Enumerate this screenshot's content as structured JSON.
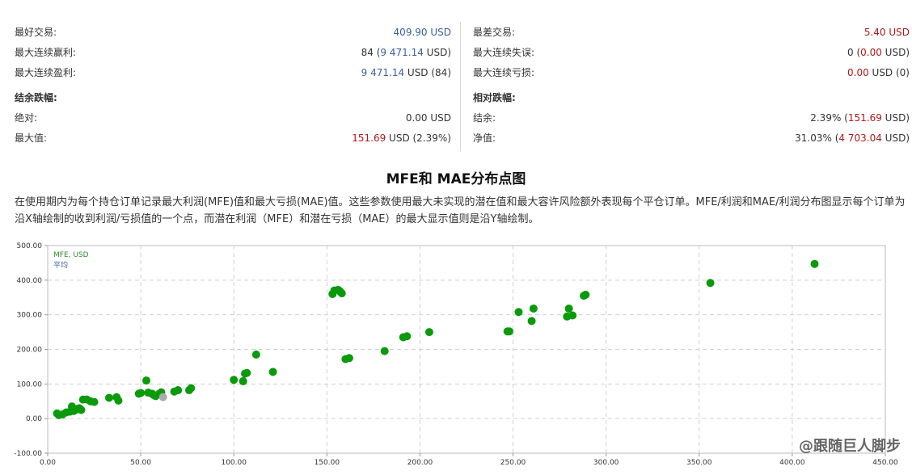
{
  "stats": {
    "left": [
      {
        "label": "最好交易:",
        "value": "409.90 USD",
        "tone": "blue"
      },
      {
        "label": "最大连续赢利:",
        "value": "84 (9 471.14 USD)",
        "tone": "mixed",
        "parts": [
          "84 (",
          "9 471.14",
          " USD)"
        ]
      },
      {
        "label": "最大连续盈利:",
        "value": "9 471.14 USD (84)",
        "tone": "mixed",
        "parts": [
          "",
          "9 471.14",
          " USD (84)"
        ]
      },
      {
        "label": "结余跌幅:",
        "value": "",
        "head": true
      },
      {
        "label": "绝对:",
        "value": "0.00 USD",
        "tone": "plain"
      },
      {
        "label": "最大值:",
        "value": "151.69 USD (2.39%)",
        "tone": "mixedred",
        "parts": [
          "",
          "151.69",
          " USD (2.39%)"
        ]
      }
    ],
    "right": [
      {
        "label": "最差交易:",
        "value": "5.40 USD",
        "tone": "red"
      },
      {
        "label": "最大连续失误:",
        "value": "0 (0.00 USD)",
        "tone": "mixedred",
        "parts": [
          "0 (",
          "0.00",
          " USD)"
        ]
      },
      {
        "label": "最大连续亏损:",
        "value": "0.00 USD (0)",
        "tone": "mixedred",
        "parts": [
          "",
          "0.00",
          " USD (0)"
        ]
      },
      {
        "label": "相对跌幅:",
        "value": "",
        "head": true
      },
      {
        "label": "结余:",
        "value": "2.39% (151.69 USD)",
        "tone": "mixedred",
        "parts": [
          "2.39% (",
          "151.69",
          " USD)"
        ]
      },
      {
        "label": "净值:",
        "value": "31.03% (4 703.04 USD)",
        "tone": "mixedred",
        "parts": [
          "31.03% (",
          "4 703.04",
          " USD)"
        ]
      }
    ]
  },
  "section_title": "MFE和 MAE分布点图",
  "description": "在使用期内为每个持仓订单记录最大利润(MFE)值和最大亏损(MAE)值。这些参数使用最大未实现的潜在值和最大容许风险额外表现每个平仓订单。MFE/利润和MAE/利润分布图显示每个订单为沿X轴绘制的收到利润/亏损值的一个点，而潜在利润（MFE）和潜在亏损（MAE）的最大显示值则是沿Y轴绘制。",
  "watermark": "@跟随巨人脚步",
  "colors": {
    "series": "#0b9a0b",
    "average": "#aaaaaa",
    "grid": "#d0d0d0",
    "blue": "#3a5fa0",
    "red": "#b01818"
  },
  "chart_data": {
    "type": "scatter",
    "xlim": [
      0,
      450
    ],
    "ylim": [
      -100,
      500
    ],
    "x_ticks": [
      "0.00",
      "50.00",
      "100.00",
      "150.00",
      "200.00",
      "250.00",
      "300.00",
      "350.00",
      "400.00",
      "450.00"
    ],
    "y_ticks": [
      "500.00",
      "400.00",
      "300.00",
      "200.00",
      "100.00",
      "0.00",
      "-100.00"
    ],
    "legend": [
      "MFE, USD",
      "平均"
    ],
    "legend_position": "top-left",
    "grid": true,
    "series": [
      {
        "name": "MFE, USD",
        "points": [
          [
            5,
            15
          ],
          [
            6,
            10
          ],
          [
            8,
            12
          ],
          [
            10,
            18
          ],
          [
            12,
            20
          ],
          [
            13,
            35
          ],
          [
            14,
            22
          ],
          [
            15,
            25
          ],
          [
            16,
            28
          ],
          [
            17,
            30
          ],
          [
            18,
            25
          ],
          [
            19,
            55
          ],
          [
            21,
            55
          ],
          [
            23,
            50
          ],
          [
            25,
            48
          ],
          [
            33,
            60
          ],
          [
            37,
            62
          ],
          [
            38,
            52
          ],
          [
            49,
            72
          ],
          [
            50,
            74
          ],
          [
            53,
            110
          ],
          [
            54,
            75
          ],
          [
            56,
            72
          ],
          [
            57,
            68
          ],
          [
            58,
            65
          ],
          [
            60,
            72
          ],
          [
            61,
            76
          ],
          [
            68,
            78
          ],
          [
            70,
            82
          ],
          [
            76,
            82
          ],
          [
            77,
            88
          ],
          [
            100,
            112
          ],
          [
            105,
            108
          ],
          [
            106,
            130
          ],
          [
            107,
            132
          ],
          [
            112,
            185
          ],
          [
            121,
            135
          ],
          [
            153,
            360
          ],
          [
            154,
            370
          ],
          [
            156,
            372
          ],
          [
            157,
            368
          ],
          [
            158,
            362
          ],
          [
            160,
            172
          ],
          [
            162,
            175
          ],
          [
            181,
            195
          ],
          [
            191,
            235
          ],
          [
            193,
            238
          ],
          [
            205,
            250
          ],
          [
            247,
            252
          ],
          [
            248,
            252
          ],
          [
            253,
            308
          ],
          [
            260,
            282
          ],
          [
            261,
            318
          ],
          [
            279,
            295
          ],
          [
            280,
            318
          ],
          [
            282,
            298
          ],
          [
            288,
            355
          ],
          [
            289,
            358
          ],
          [
            356,
            392
          ],
          [
            412,
            447
          ]
        ]
      },
      {
        "name": "平均",
        "points": [
          [
            62,
            62
          ]
        ]
      }
    ]
  }
}
